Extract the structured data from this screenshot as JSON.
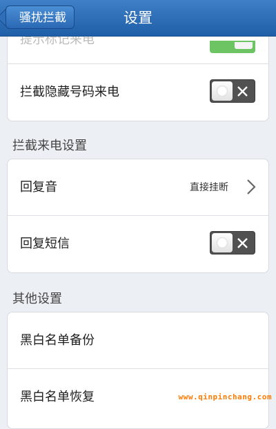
{
  "navbar": {
    "back_label": "骚扰拦截",
    "title": "设置"
  },
  "group1": {
    "partial_row_label": "提示标记来电",
    "partial_toggle_state": "on",
    "hidden_number_label": "拦截隐藏号码来电",
    "hidden_number_toggle": "off"
  },
  "section_block_settings": {
    "header": "拦截来电设置",
    "reply_tone_label": "回复音",
    "reply_tone_value": "直接挂断",
    "reply_sms_label": "回复短信",
    "reply_sms_toggle": "off"
  },
  "section_other": {
    "header": "其他设置",
    "backup_label": "黑白名单备份",
    "restore_label": "黑白名单恢复"
  },
  "watermark": "www.qinpinchang.com",
  "colors": {
    "navbar": "#2a6bb5",
    "toggle_on": "#6cc463",
    "toggle_off": "#515151",
    "watermark": "#ff7a00"
  }
}
